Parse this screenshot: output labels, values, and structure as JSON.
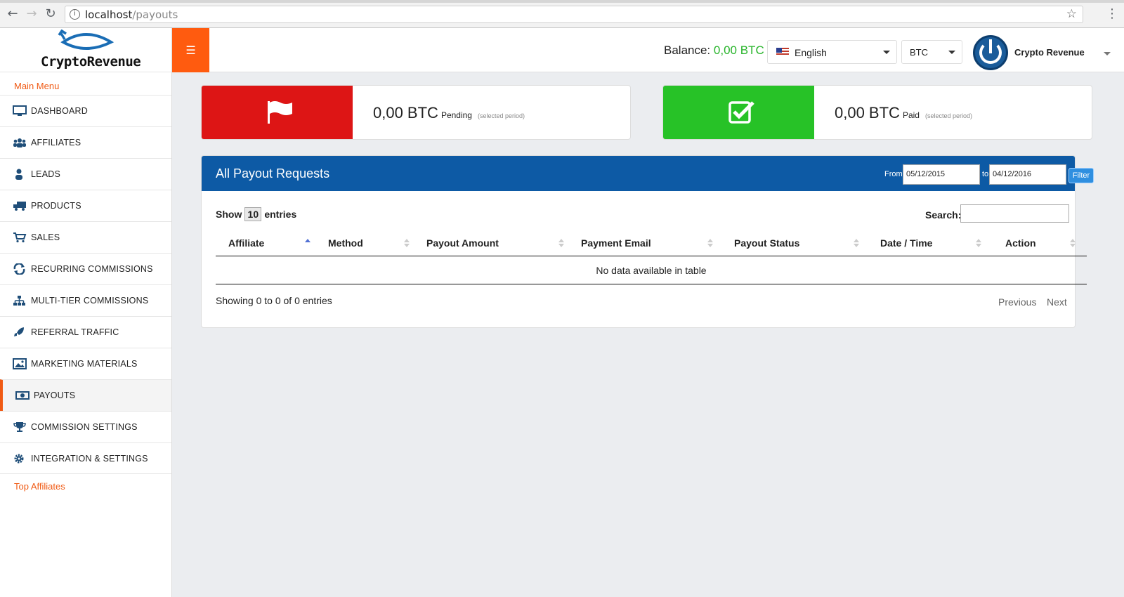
{
  "browser": {
    "url_host": "localhost",
    "url_path": "/payouts"
  },
  "sidebar": {
    "logo": "CryptoRevenue",
    "main_menu_label": "Main Menu",
    "items": [
      {
        "label": "DASHBOARD",
        "icon": "monitor-icon"
      },
      {
        "label": "AFFILIATES",
        "icon": "users-icon"
      },
      {
        "label": "LEADS",
        "icon": "user-icon"
      },
      {
        "label": "PRODUCTS",
        "icon": "truck-icon"
      },
      {
        "label": "SALES",
        "icon": "cart-icon"
      },
      {
        "label": "RECURRING COMMISSIONS",
        "icon": "refresh-icon"
      },
      {
        "label": "MULTI-TIER COMMISSIONS",
        "icon": "sitemap-icon"
      },
      {
        "label": "REFERRAL TRAFFIC",
        "icon": "rocket-icon"
      },
      {
        "label": "MARKETING MATERIALS",
        "icon": "image-icon"
      },
      {
        "label": "PAYOUTS",
        "icon": "money-icon",
        "active": true
      },
      {
        "label": "COMMISSION SETTINGS",
        "icon": "trophy-icon"
      },
      {
        "label": "INTEGRATION & SETTINGS",
        "icon": "gear-icon"
      }
    ],
    "top_affiliates_label": "Top Affiliates"
  },
  "topbar": {
    "balance_label": "Balance:",
    "balance_value": "0,00 BTC",
    "language": "English",
    "currency": "BTC",
    "user_name": "Crypto Revenue"
  },
  "cards": {
    "pending": {
      "value": "0,00 BTC",
      "label": "Pending",
      "period": "(selected period)",
      "color": "#dd1515"
    },
    "paid": {
      "value": "0,00 BTC",
      "label": "Paid",
      "period": "(selected period)",
      "color": "#27c227"
    }
  },
  "panel": {
    "title": "All Payout Requests",
    "from_label": "From",
    "from_date": "05/12/2015",
    "to_label": "to",
    "to_date": "04/12/2016",
    "filter_label": "Filter",
    "show_label": "Show",
    "show_count": "10",
    "entries_label": "entries",
    "search_label": "Search:",
    "columns": [
      "Affiliate",
      "Method",
      "Payout Amount",
      "Payment Email",
      "Payout Status",
      "Date / Time",
      "Action"
    ],
    "empty_message": "No data available in table",
    "info": "Showing 0 to 0 of 0 entries",
    "prev_label": "Previous",
    "next_label": "Next"
  },
  "colors": {
    "accent": "#ff5b0f",
    "header_blue": "#0d5aa5",
    "balance_green": "#27b42a"
  }
}
